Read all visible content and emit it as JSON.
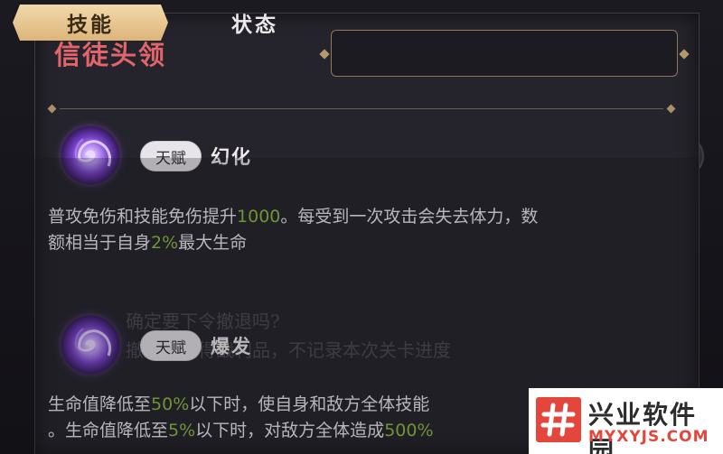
{
  "header": {
    "title": "信徒头领"
  },
  "tabs": [
    {
      "label": "技能",
      "active": true
    },
    {
      "label": "状态",
      "active": false
    }
  ],
  "skills": [
    {
      "tag": "天赋",
      "name": "幻化",
      "icon": "purple-vortex-icon",
      "desc_line1": {
        "a": "普攻免伤和技能免伤提升",
        "v1": "1000",
        "b": "。每受到一次攻击会失去体力，数"
      },
      "desc_line2": {
        "a": "额相当于自身",
        "v1": "2%",
        "b": "最大生命"
      }
    },
    {
      "tag": "天赋",
      "name": "爆发",
      "icon": "purple-vortex-icon",
      "desc_line1": {
        "a": "生命值降低至",
        "v1": "50%",
        "b": "以下时，使自身和敌方全体技能"
      },
      "desc_line2": {
        "a": "。生命值降低至",
        "v1": "5%",
        "b": "以下时，对敌方全体造成",
        "v2": "500%"
      }
    }
  ],
  "background_dialog": {
    "line1": "确定要下令撤退吗?",
    "line2": "撤退将获得战利品，不记录本次关卡进度"
  },
  "watermark": {
    "title": "兴业软件园",
    "url": "MYXYJS.COM"
  },
  "colors": {
    "title": "#e0666b",
    "highlight": "#8fbf3f",
    "tab_active": "#dcb57a",
    "watermark_red": "#e4463c"
  }
}
